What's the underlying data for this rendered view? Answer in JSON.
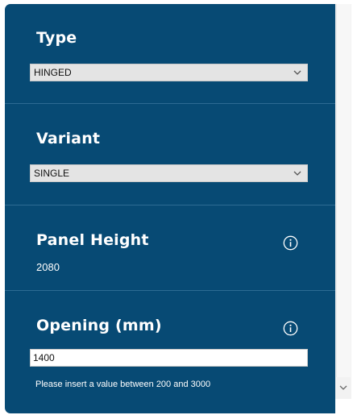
{
  "type_section": {
    "heading": "Type",
    "selected": "HINGED"
  },
  "variant_section": {
    "heading": "Variant",
    "selected": "SINGLE"
  },
  "panel_height_section": {
    "heading": "Panel Height",
    "value": "2080"
  },
  "opening_section": {
    "heading": "Opening (mm)",
    "input_value": "1400",
    "hint": "Please insert a value between 200 and 3000"
  },
  "icons": {
    "info": "info-circle-icon",
    "dropdown": "chevron-down-icon",
    "scroll_down": "scroll-down-arrow-icon"
  },
  "colors": {
    "panel_background": "#074a74",
    "divider": "#2d6b93",
    "select_background": "#e4e4e4",
    "text_on_panel": "#ffffff"
  }
}
